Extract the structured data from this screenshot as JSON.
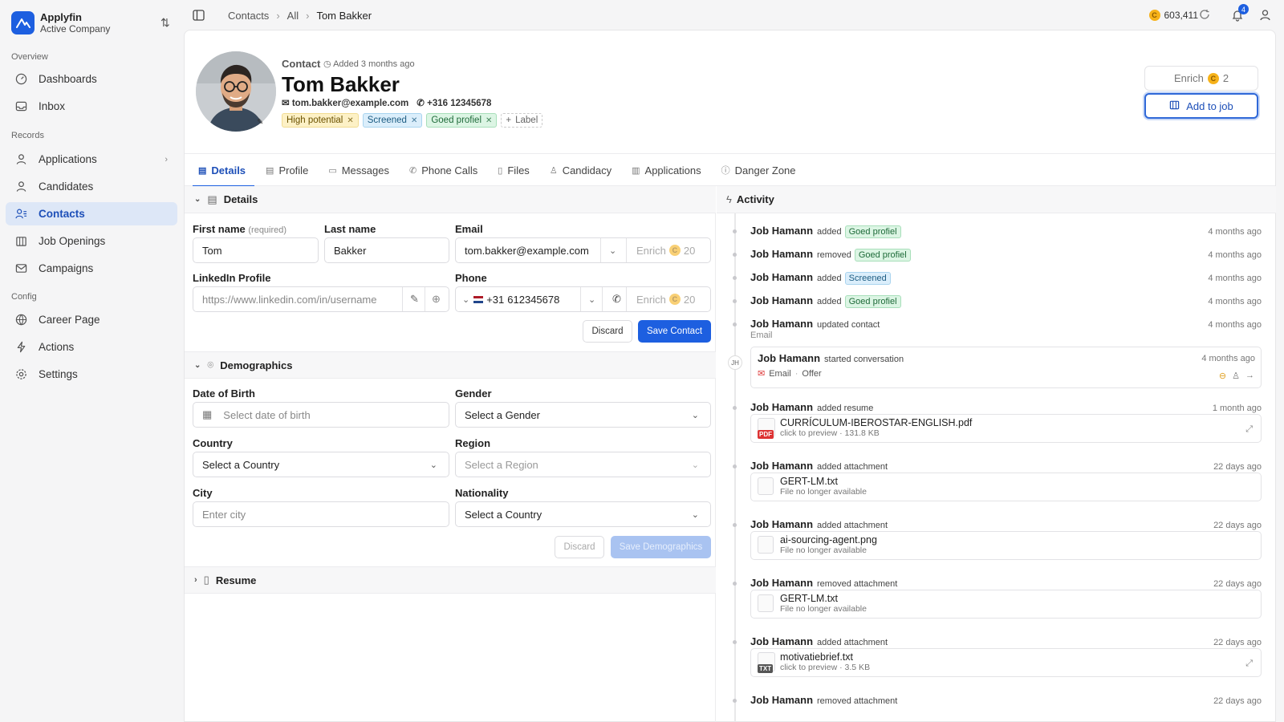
{
  "app": {
    "name": "Applyfin",
    "company": "Active Company"
  },
  "sidebar": {
    "sections": [
      {
        "label": "Overview"
      },
      {
        "label": "Records"
      },
      {
        "label": "Config"
      }
    ],
    "items": [
      {
        "label": "Dashboards",
        "icon": "dashboard-icon"
      },
      {
        "label": "Inbox",
        "icon": "inbox-icon"
      },
      {
        "label": "Applications",
        "icon": "applications-icon"
      },
      {
        "label": "Candidates",
        "icon": "candidates-icon"
      },
      {
        "label": "Contacts",
        "icon": "contacts-icon"
      },
      {
        "label": "Job Openings",
        "icon": "job-openings-icon"
      },
      {
        "label": "Campaigns",
        "icon": "campaigns-icon"
      },
      {
        "label": "Career Page",
        "icon": "globe-icon"
      },
      {
        "label": "Actions",
        "icon": "lightning-icon"
      },
      {
        "label": "Settings",
        "icon": "gear-icon"
      }
    ]
  },
  "topbar": {
    "breadcrumbs": [
      "Contacts",
      "All",
      "Tom Bakker"
    ],
    "credits": "603,411",
    "notifications": "4"
  },
  "header": {
    "type": "Contact",
    "added": "Added 3 months ago",
    "name": "Tom Bakker",
    "email": "tom.bakker@example.com",
    "phone": "+316 12345678",
    "tags": [
      "High potential",
      "Screened",
      "Goed profiel"
    ],
    "add_label": "Label",
    "enrich_label": "Enrich",
    "enrich_cost": "2",
    "add_to_job": "Add to job"
  },
  "tabs": [
    "Details",
    "Profile",
    "Messages",
    "Phone Calls",
    "Files",
    "Candidacy",
    "Applications",
    "Danger Zone"
  ],
  "details": {
    "title": "Details",
    "first_name_label": "First name",
    "required": "(required)",
    "first_name": "Tom",
    "last_name_label": "Last name",
    "last_name": "Bakker",
    "email_label": "Email",
    "email": "tom.bakker@example.com",
    "enrich": "Enrich",
    "enrich_cost": "20",
    "linkedin_label": "LinkedIn Profile",
    "linkedin_placeholder": "https://www.linkedin.com/in/username",
    "phone_label": "Phone",
    "phone_code": "+31",
    "phone_number": "612345678",
    "discard": "Discard",
    "save": "Save Contact"
  },
  "demographics": {
    "title": "Demographics",
    "dob_label": "Date of Birth",
    "dob_placeholder": "Select date of birth",
    "gender_label": "Gender",
    "gender_value": "Select a Gender",
    "country_label": "Country",
    "country_value": "Select a Country",
    "region_label": "Region",
    "region_value": "Select a Region",
    "city_label": "City",
    "city_placeholder": "Enter city",
    "nationality_label": "Nationality",
    "nationality_value": "Select a Country",
    "discard": "Discard",
    "save": "Save Demographics"
  },
  "resume": {
    "title": "Resume"
  },
  "activity": {
    "title": "Activity",
    "events": [
      {
        "who": "Job Hamann",
        "action": "added",
        "chip": "Goed profiel",
        "time": "4 months ago"
      },
      {
        "who": "Job Hamann",
        "action": "removed",
        "chip": "Goed profiel",
        "time": "4 months ago"
      },
      {
        "who": "Job Hamann",
        "action": "added",
        "chip": "Screened",
        "time": "4 months ago"
      },
      {
        "who": "Job Hamann",
        "action": "added",
        "chip": "Goed profiel",
        "time": "4 months ago"
      },
      {
        "who": "Job Hamann",
        "action": "updated contact",
        "sub": "Email",
        "time": "4 months ago"
      },
      {
        "who": "Job Hamann",
        "action": "started conversation",
        "channel": "Email",
        "context": "Offer",
        "time": "4 months ago",
        "initials": "JH"
      },
      {
        "who": "Job Hamann",
        "action": "added resume",
        "file": "CURRÍCULUM-IBEROSTAR-ENGLISH.pdf",
        "file_type": "PDF",
        "preview": "click to preview",
        "size": "131.8 KB",
        "time": "1 month ago"
      },
      {
        "who": "Job Hamann",
        "action": "added attachment",
        "file": "GERT-LM.txt",
        "status": "File no longer available",
        "time": "22 days ago"
      },
      {
        "who": "Job Hamann",
        "action": "added attachment",
        "file": "ai-sourcing-agent.png",
        "status": "File no longer available",
        "time": "22 days ago"
      },
      {
        "who": "Job Hamann",
        "action": "removed attachment",
        "file": "GERT-LM.txt",
        "status": "File no longer available",
        "time": "22 days ago"
      },
      {
        "who": "Job Hamann",
        "action": "added attachment",
        "file": "motivatiebrief.txt",
        "file_type": "TXT",
        "preview": "click to preview",
        "size": "3.5 KB",
        "time": "22 days ago"
      },
      {
        "who": "Job Hamann",
        "action": "removed attachment",
        "time": "22 days ago"
      }
    ]
  },
  "colors": {
    "accent": "#1d5fe0",
    "active_bg": "#dde7f7"
  }
}
